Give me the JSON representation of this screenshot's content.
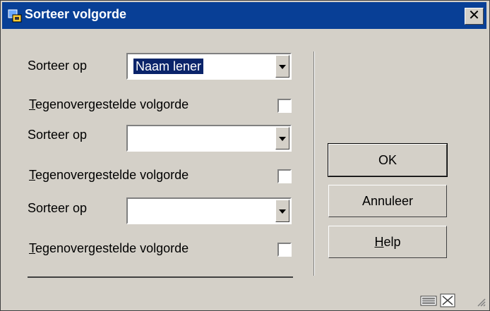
{
  "window": {
    "title": "Sorteer volgorde",
    "close": "✕"
  },
  "rows": [
    {
      "sort_label": "Sorteer op",
      "sort_value": "Naam lener",
      "reverse_label_first": "T",
      "reverse_label_rest": "egenovergestelde volgorde"
    },
    {
      "sort_label": "Sorteer op",
      "sort_value": "",
      "reverse_label_first": "T",
      "reverse_label_rest": "egenovergestelde volgorde"
    },
    {
      "sort_label": "Sorteer op",
      "sort_value": "",
      "reverse_label_first": "T",
      "reverse_label_rest": "egenovergestelde volgorde"
    }
  ],
  "buttons": {
    "ok": "OK",
    "cancel": "Annuleer",
    "help_first": "H",
    "help_rest": "elp"
  },
  "icons": {
    "window": "app-icon",
    "keyboard": "keyboard-icon",
    "resize": "resize-icon"
  }
}
